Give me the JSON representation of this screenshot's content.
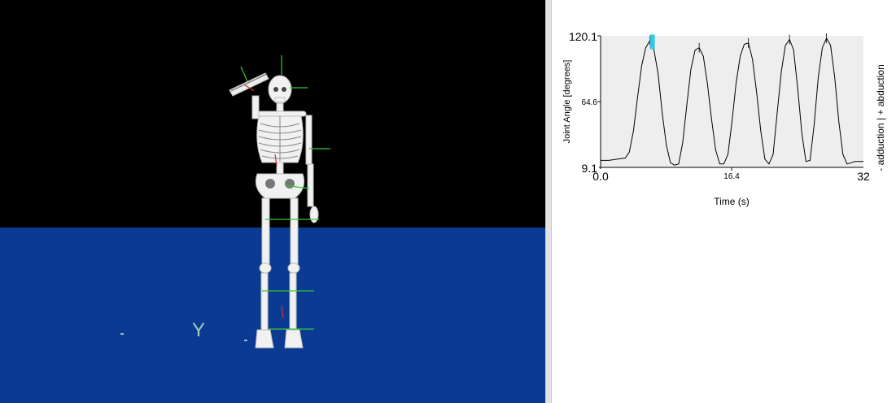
{
  "viewport": {
    "axis_label": "Y",
    "colors": {
      "sky": "#000000",
      "floor": "#0a3a92",
      "bone": "#f2f2f2",
      "marker_green": "#37c837",
      "marker_red": "#d23232"
    }
  },
  "plot": {
    "ylabel": "Joint Angle [degrees]",
    "right_label": "- adduction | + abduction",
    "xlabel": "Time (s)",
    "y_ticks": [
      "120.1",
      "64.6",
      "9.1"
    ],
    "x_ticks": [
      "0.0",
      "16.4",
      "32"
    ]
  },
  "chart_data": {
    "type": "line",
    "title": "",
    "xlabel": "Time (s)",
    "ylabel": "Joint Angle [degrees]",
    "xlim": [
      0,
      32
    ],
    "ylim": [
      9.1,
      120.1
    ],
    "grid": false,
    "legend": "none",
    "current_time_marker": {
      "x": 6.3,
      "y": 117,
      "color": "#35c8e6"
    },
    "series": [
      {
        "color": "#000000",
        "x": [
          0,
          1,
          2,
          3,
          3.5,
          4,
          4.5,
          5,
          5.5,
          6,
          6.5,
          7,
          7.5,
          8,
          8.5,
          9,
          9.5,
          10,
          10.5,
          11,
          11.5,
          12,
          12.5,
          13,
          13.5,
          14,
          14.5,
          15,
          15.5,
          16,
          16.5,
          17,
          17.5,
          18,
          18.5,
          19,
          19.5,
          20,
          20.5,
          21,
          21.5,
          22,
          22.5,
          23,
          23.5,
          24,
          24.5,
          25,
          25.5,
          26,
          26.5,
          27,
          27.5,
          28,
          28.5,
          29,
          29.5,
          30,
          30.5,
          31,
          32
        ],
        "y": [
          15,
          15,
          16,
          17,
          22,
          40,
          68,
          95,
          110,
          116,
          108,
          88,
          55,
          28,
          13,
          11,
          12,
          30,
          62,
          92,
          108,
          110,
          103,
          80,
          50,
          24,
          12,
          12,
          20,
          48,
          80,
          103,
          113,
          114,
          100,
          72,
          40,
          16,
          12,
          20,
          55,
          90,
          112,
          117,
          108,
          75,
          38,
          14,
          15,
          45,
          85,
          110,
          118,
          112,
          85,
          48,
          20,
          12,
          13,
          14,
          14
        ]
      }
    ]
  }
}
